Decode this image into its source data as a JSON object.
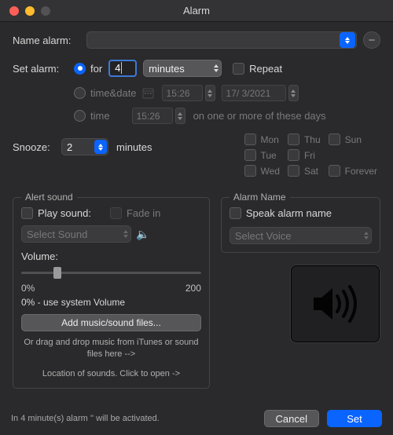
{
  "window": {
    "title": "Alarm"
  },
  "name": {
    "label": "Name alarm:",
    "value": ""
  },
  "setAlarm": {
    "label": "Set alarm:",
    "options": {
      "for": {
        "label": "for",
        "value": "4",
        "unit": "minutes"
      },
      "timeDate": {
        "label": "time&date",
        "time": "15:26",
        "date": "17/ 3/2021"
      },
      "time": {
        "label": "time",
        "time": "15:26",
        "hint": "on one or more of these days"
      }
    },
    "repeat": {
      "label": "Repeat"
    }
  },
  "days": {
    "mon": "Mon",
    "tue": "Tue",
    "wed": "Wed",
    "thu": "Thu",
    "fri": "Fri",
    "sat": "Sat",
    "sun": "Sun",
    "forever": "Forever"
  },
  "snooze": {
    "label": "Snooze:",
    "value": "2",
    "unit": "minutes"
  },
  "alert": {
    "title": "Alert sound",
    "play": "Play sound:",
    "fade": "Fade in",
    "select": "Select Sound",
    "volume": "Volume:",
    "min": "0%",
    "max": "200",
    "sysvol": "0% - use system Volume",
    "addBtn": "Add music/sound files...",
    "dragHint": "Or drag and drop music from iTunes or sound files here -->",
    "locHint": "Location of sounds. Click to open ->"
  },
  "alarmName": {
    "title": "Alarm Name",
    "speak": "Speak alarm name",
    "voice": "Select Voice"
  },
  "footer": {
    "status": "In 4 minute(s) alarm '' will be activated.",
    "cancel": "Cancel",
    "set": "Set"
  }
}
